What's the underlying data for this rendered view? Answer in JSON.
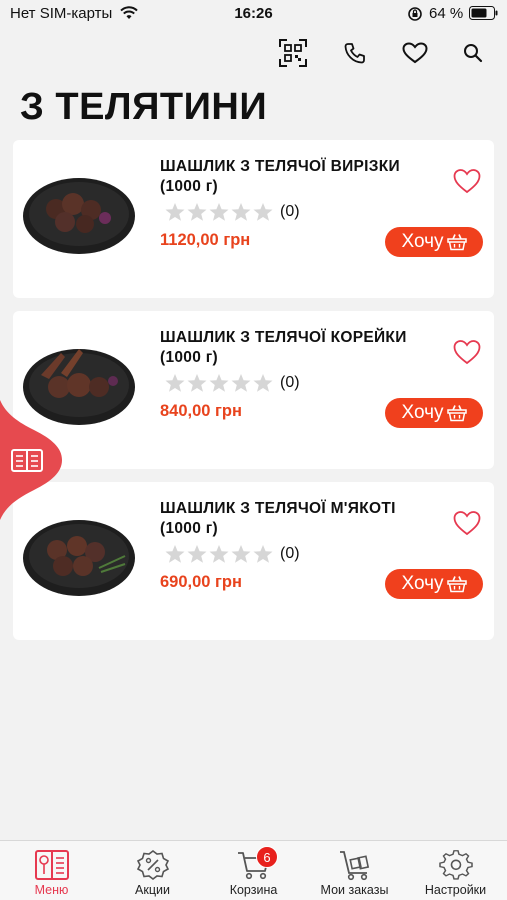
{
  "status_bar": {
    "carrier": "Нет SIM-карты",
    "time": "16:26",
    "battery": "64 %"
  },
  "page": {
    "title": "З ТЕЛЯТИНИ"
  },
  "products": [
    {
      "name": "ШАШЛИК З ТЕЛЯЧОЇ ВИРІЗКИ (1000 г)",
      "rating_count": "(0)",
      "rating": 0,
      "price": "1120,00 грн",
      "button": "Хочу"
    },
    {
      "name": "ШАШЛИК З ТЕЛЯЧОЇ КОРЕЙКИ (1000 г)",
      "rating_count": "(0)",
      "rating": 0,
      "price": "840,00 грн",
      "button": "Хочу"
    },
    {
      "name": "ШАШЛИК З ТЕЛЯЧОЇ М'ЯКОТІ (1000 г)",
      "rating_count": "(0)",
      "rating": 0,
      "price": "690,00 грн",
      "button": "Хочу"
    }
  ],
  "tabbar": {
    "items": [
      {
        "label": "Меню",
        "icon": "menu-book-icon",
        "active": true
      },
      {
        "label": "Акции",
        "icon": "discount-badge-icon"
      },
      {
        "label": "Корзина",
        "icon": "cart-icon"
      },
      {
        "label": "Мои заказы",
        "icon": "delivery-cart-icon"
      },
      {
        "label": "Настройки",
        "icon": "gear-icon"
      }
    ],
    "cart_badge": "6"
  },
  "colors": {
    "accent": "#f0401d",
    "price": "#e8431d",
    "heart": "#e63950",
    "active_tab": "#e63950"
  }
}
